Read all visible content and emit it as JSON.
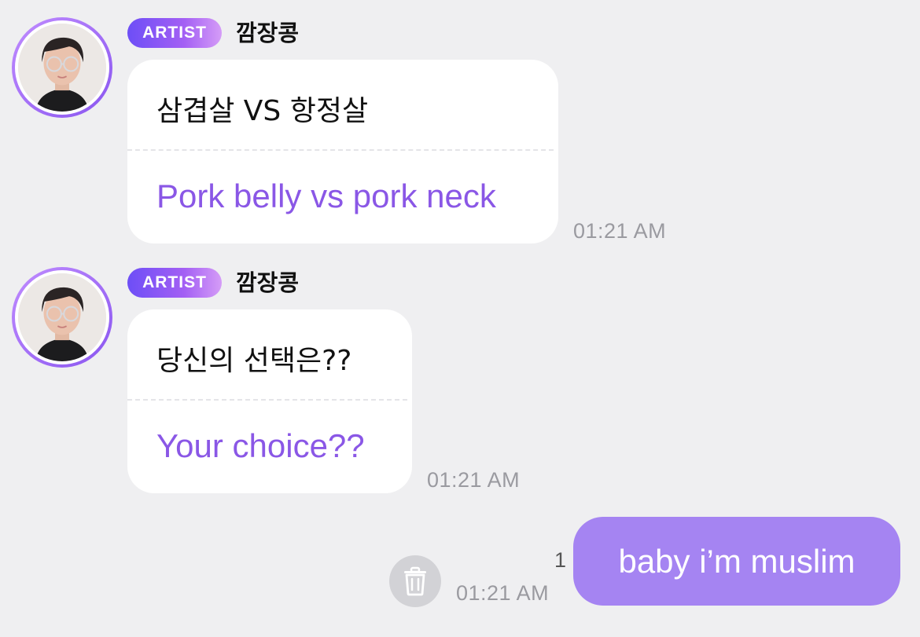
{
  "colors": {
    "background": "#efeff1",
    "translation_text": "#8a57e6",
    "my_bubble": "#a584f2",
    "badge_gradient_start": "#6d4ef6",
    "badge_gradient_end": "#d59cf7"
  },
  "messages": [
    {
      "badge": "ARTIST",
      "sender": "깜장콩",
      "original": "삼겹살 VS 항정살",
      "translation": "Pork belly vs pork neck",
      "time": "01:21 AM",
      "avatar_icon": "artist-avatar"
    },
    {
      "badge": "ARTIST",
      "sender": "깜장콩",
      "original": "당신의 선택은??",
      "translation": "Your choice??",
      "time": "01:21 AM",
      "avatar_icon": "artist-avatar"
    }
  ],
  "my_message": {
    "text": "baby i’m muslim",
    "time": "01:21 AM",
    "unread_count": "1",
    "delete_icon": "trash-icon"
  }
}
